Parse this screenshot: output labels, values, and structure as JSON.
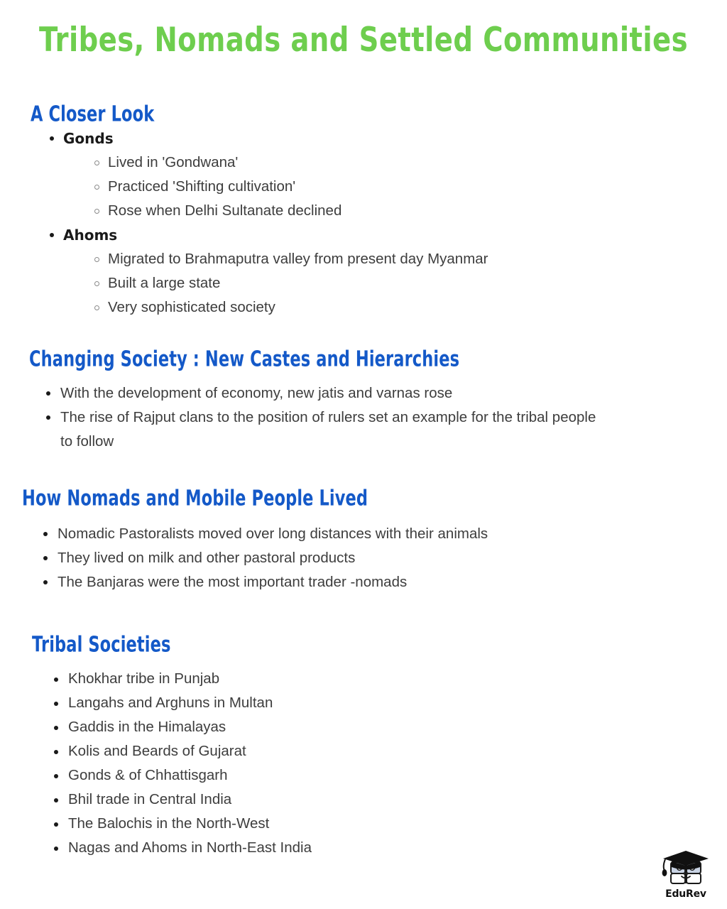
{
  "document": {
    "title": "Tribes, Nomads and Settled Communities",
    "title_color": "#6ECE4E",
    "heading_color": "#1459C8",
    "body_color": "#3d3d3d"
  },
  "sections": [
    {
      "heading": "A Closer Look",
      "items": [
        {
          "label": "Gonds",
          "children": [
            "Lived in 'Gondwana'",
            "Practiced 'Shifting cultivation'",
            "Rose when Delhi Sultanate declined"
          ]
        },
        {
          "label": "Ahoms",
          "children": [
            "Migrated to Brahmaputra valley from present day Myanmar",
            "Built a large state",
            "Very sophisticated society"
          ]
        }
      ]
    },
    {
      "heading": "Changing Society : New Castes and Hierarchies",
      "bullets": [
        "With the development of economy, new jatis and varnas rose",
        "The rise of Rajput clans to the position of rulers set an example for the tribal people to follow"
      ]
    },
    {
      "heading": "How Nomads and Mobile People Lived",
      "bullets": [
        "Nomadic Pastoralists moved over long distances with their animals",
        "They lived on milk and other pastoral products",
        "The Banjaras were the most important trader -nomads"
      ]
    },
    {
      "heading": "Tribal Societies",
      "bullets": [
        "Khokhar tribe in Punjab",
        "Langahs and Arghuns in Multan",
        "Gaddis in the Himalayas",
        "Kolis and Beards of Gujarat",
        "Gonds & of Chhattisgarh",
        "Bhil trade in Central India",
        "The Balochis in the North-West",
        "Nagas and Ahoms in North-East India"
      ]
    }
  ],
  "logo": {
    "wordmark": "EduRev",
    "icon": "graduation-cap-book-mascot"
  }
}
